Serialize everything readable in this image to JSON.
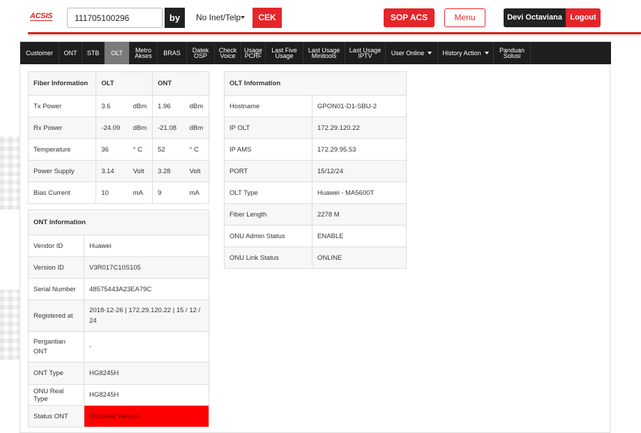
{
  "header": {
    "logo": "ACSIS",
    "search_value": "111705100296",
    "by_label": "by",
    "select_value": "No Inet/Telp",
    "cek_label": "CEK",
    "sop_label": "SOP ACS",
    "menu_label": "Menu",
    "user_name": "Devi Octaviana",
    "logout_label": "Logout"
  },
  "nav": {
    "items": [
      {
        "label": "Customer"
      },
      {
        "label": "ONT"
      },
      {
        "label": "STB"
      },
      {
        "label": "OLT",
        "active": true
      },
      {
        "label1": "Metro",
        "label2": "Akses"
      },
      {
        "label": "BRAS"
      },
      {
        "label1": "Datek",
        "label2": "OSP"
      },
      {
        "label1": "Check",
        "label2": "Voice"
      },
      {
        "label1": "Usage",
        "label2": "PCRF"
      },
      {
        "label1": "Last Five",
        "label2": "Usage"
      },
      {
        "label1": "Last Usage",
        "label2": "Minitools"
      },
      {
        "label1": "Last Usage",
        "label2": "IPTV"
      },
      {
        "label": "User Online"
      },
      {
        "label": "History Action"
      },
      {
        "label1": "Panduan",
        "label2": "Solusi"
      }
    ]
  },
  "fiber": {
    "title": "Fiber Information",
    "col_olt": "OLT",
    "col_ont": "ONT",
    "rows": [
      {
        "label": "Tx Power",
        "olt": "3.6",
        "olt_unit": "dBm",
        "ont": "1.96",
        "ont_unit": "dBm"
      },
      {
        "label": "Rx Power",
        "olt": "-24.09",
        "olt_unit": "dBm",
        "ont": "-21.08",
        "ont_unit": "dBm"
      },
      {
        "label": "Temperature",
        "olt": "36",
        "olt_unit": "° C",
        "ont": "52",
        "ont_unit": "° C"
      },
      {
        "label": "Power Supply",
        "olt": "3.14",
        "olt_unit": "Volt",
        "ont": "3.28",
        "ont_unit": "Volt"
      },
      {
        "label": "Bias Current",
        "olt": "10",
        "olt_unit": "mA",
        "ont": "9",
        "ont_unit": "mA"
      }
    ]
  },
  "ont_info": {
    "title": "ONT Information",
    "vendor_label": "Vendor ID",
    "vendor": "Huawei",
    "version_label": "Version ID",
    "version": "V3R017C10S105",
    "serial_label": "Serial Number",
    "serial": "48575443A23EA79C",
    "registered_label": "Registered at",
    "registered": "2018-12-26 | 172.29.120.22 | 15 / 12 / 24",
    "pergantian_label": "Pergantian ONT",
    "pergantian": "-",
    "type_label": "ONT Type",
    "type": "HG8245H",
    "real_type_label": "ONU Real Type",
    "real_type": "HG8245H",
    "status_label": "Status ONT",
    "status": "Obsolete Version",
    "status_color": "#ff0000"
  },
  "olt_info": {
    "title": "OLT Information",
    "rows": [
      {
        "label": "Hostname",
        "value": "GPON01-D1-SBU-2"
      },
      {
        "label": "IP OLT",
        "value": "172.29.120.22"
      },
      {
        "label": "IP AMS",
        "value": "172.29.95.53"
      },
      {
        "label": "PORT",
        "value": "15/12/24"
      },
      {
        "label": "OLT Type",
        "value": "Huawei - MA5600T"
      },
      {
        "label": "Fiber Length",
        "value": "2278 M"
      },
      {
        "label": "ONU Admin Status",
        "value": "ENABLE"
      },
      {
        "label": "ONU Link Status",
        "value": "ONLINE"
      }
    ]
  },
  "colors": {
    "accent_red": "#e4262a",
    "nav_bg": "#1e1e1e",
    "nav_active": "#7a7a7a"
  }
}
